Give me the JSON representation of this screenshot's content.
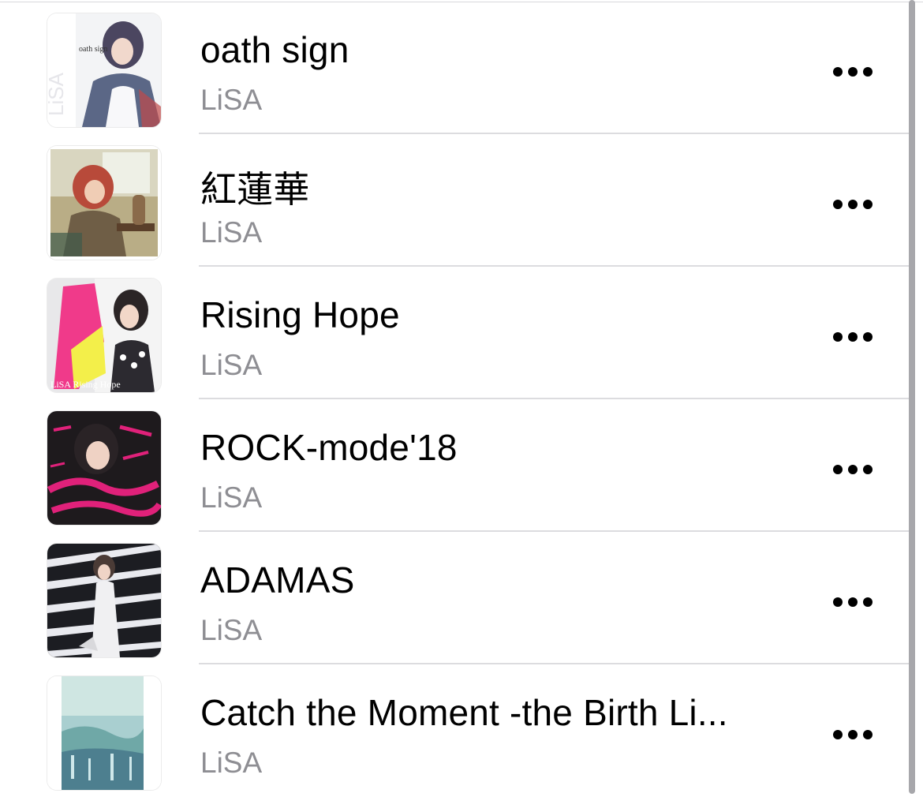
{
  "songs": [
    {
      "title": "oath sign",
      "artist": "LiSA",
      "artwork": "oath-sign-cover"
    },
    {
      "title": "紅蓮華",
      "artist": "LiSA",
      "artwork": "gurenge-cover"
    },
    {
      "title": "Rising Hope",
      "artist": "LiSA",
      "artwork": "rising-hope-cover"
    },
    {
      "title": "ROCK-mode'18",
      "artist": "LiSA",
      "artwork": "lisa-best-way-cover"
    },
    {
      "title": "ADAMAS",
      "artist": "LiSA",
      "artwork": "adamas-cover"
    },
    {
      "title": "Catch the Moment -the Birth Li...",
      "artist": "LiSA",
      "artwork": "catch-the-moment-cover"
    }
  ],
  "icons": {
    "more": "ellipsis-icon",
    "scroll": "scroll-indicator"
  },
  "colors": {
    "title": "#000000",
    "subtitle": "#8e8e93",
    "separator": "#dcdcdf"
  }
}
